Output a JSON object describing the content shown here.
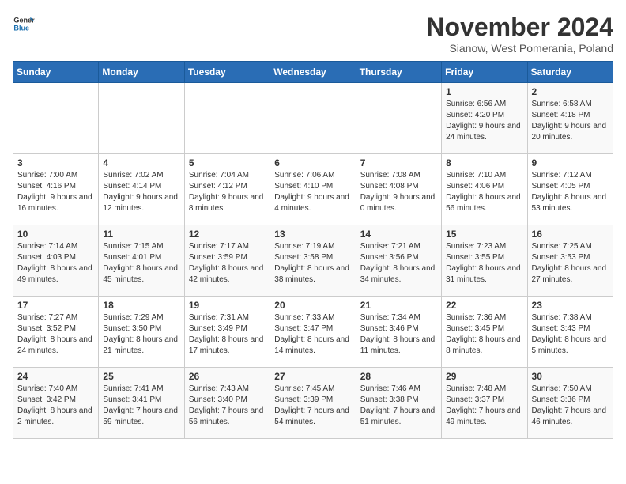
{
  "logo": {
    "general": "General",
    "blue": "Blue"
  },
  "title": "November 2024",
  "subtitle": "Sianow, West Pomerania, Poland",
  "days_of_week": [
    "Sunday",
    "Monday",
    "Tuesday",
    "Wednesday",
    "Thursday",
    "Friday",
    "Saturday"
  ],
  "weeks": [
    [
      {
        "day": "",
        "info": ""
      },
      {
        "day": "",
        "info": ""
      },
      {
        "day": "",
        "info": ""
      },
      {
        "day": "",
        "info": ""
      },
      {
        "day": "",
        "info": ""
      },
      {
        "day": "1",
        "info": "Sunrise: 6:56 AM\nSunset: 4:20 PM\nDaylight: 9 hours and 24 minutes."
      },
      {
        "day": "2",
        "info": "Sunrise: 6:58 AM\nSunset: 4:18 PM\nDaylight: 9 hours and 20 minutes."
      }
    ],
    [
      {
        "day": "3",
        "info": "Sunrise: 7:00 AM\nSunset: 4:16 PM\nDaylight: 9 hours and 16 minutes."
      },
      {
        "day": "4",
        "info": "Sunrise: 7:02 AM\nSunset: 4:14 PM\nDaylight: 9 hours and 12 minutes."
      },
      {
        "day": "5",
        "info": "Sunrise: 7:04 AM\nSunset: 4:12 PM\nDaylight: 9 hours and 8 minutes."
      },
      {
        "day": "6",
        "info": "Sunrise: 7:06 AM\nSunset: 4:10 PM\nDaylight: 9 hours and 4 minutes."
      },
      {
        "day": "7",
        "info": "Sunrise: 7:08 AM\nSunset: 4:08 PM\nDaylight: 9 hours and 0 minutes."
      },
      {
        "day": "8",
        "info": "Sunrise: 7:10 AM\nSunset: 4:06 PM\nDaylight: 8 hours and 56 minutes."
      },
      {
        "day": "9",
        "info": "Sunrise: 7:12 AM\nSunset: 4:05 PM\nDaylight: 8 hours and 53 minutes."
      }
    ],
    [
      {
        "day": "10",
        "info": "Sunrise: 7:14 AM\nSunset: 4:03 PM\nDaylight: 8 hours and 49 minutes."
      },
      {
        "day": "11",
        "info": "Sunrise: 7:15 AM\nSunset: 4:01 PM\nDaylight: 8 hours and 45 minutes."
      },
      {
        "day": "12",
        "info": "Sunrise: 7:17 AM\nSunset: 3:59 PM\nDaylight: 8 hours and 42 minutes."
      },
      {
        "day": "13",
        "info": "Sunrise: 7:19 AM\nSunset: 3:58 PM\nDaylight: 8 hours and 38 minutes."
      },
      {
        "day": "14",
        "info": "Sunrise: 7:21 AM\nSunset: 3:56 PM\nDaylight: 8 hours and 34 minutes."
      },
      {
        "day": "15",
        "info": "Sunrise: 7:23 AM\nSunset: 3:55 PM\nDaylight: 8 hours and 31 minutes."
      },
      {
        "day": "16",
        "info": "Sunrise: 7:25 AM\nSunset: 3:53 PM\nDaylight: 8 hours and 27 minutes."
      }
    ],
    [
      {
        "day": "17",
        "info": "Sunrise: 7:27 AM\nSunset: 3:52 PM\nDaylight: 8 hours and 24 minutes."
      },
      {
        "day": "18",
        "info": "Sunrise: 7:29 AM\nSunset: 3:50 PM\nDaylight: 8 hours and 21 minutes."
      },
      {
        "day": "19",
        "info": "Sunrise: 7:31 AM\nSunset: 3:49 PM\nDaylight: 8 hours and 17 minutes."
      },
      {
        "day": "20",
        "info": "Sunrise: 7:33 AM\nSunset: 3:47 PM\nDaylight: 8 hours and 14 minutes."
      },
      {
        "day": "21",
        "info": "Sunrise: 7:34 AM\nSunset: 3:46 PM\nDaylight: 8 hours and 11 minutes."
      },
      {
        "day": "22",
        "info": "Sunrise: 7:36 AM\nSunset: 3:45 PM\nDaylight: 8 hours and 8 minutes."
      },
      {
        "day": "23",
        "info": "Sunrise: 7:38 AM\nSunset: 3:43 PM\nDaylight: 8 hours and 5 minutes."
      }
    ],
    [
      {
        "day": "24",
        "info": "Sunrise: 7:40 AM\nSunset: 3:42 PM\nDaylight: 8 hours and 2 minutes."
      },
      {
        "day": "25",
        "info": "Sunrise: 7:41 AM\nSunset: 3:41 PM\nDaylight: 7 hours and 59 minutes."
      },
      {
        "day": "26",
        "info": "Sunrise: 7:43 AM\nSunset: 3:40 PM\nDaylight: 7 hours and 56 minutes."
      },
      {
        "day": "27",
        "info": "Sunrise: 7:45 AM\nSunset: 3:39 PM\nDaylight: 7 hours and 54 minutes."
      },
      {
        "day": "28",
        "info": "Sunrise: 7:46 AM\nSunset: 3:38 PM\nDaylight: 7 hours and 51 minutes."
      },
      {
        "day": "29",
        "info": "Sunrise: 7:48 AM\nSunset: 3:37 PM\nDaylight: 7 hours and 49 minutes."
      },
      {
        "day": "30",
        "info": "Sunrise: 7:50 AM\nSunset: 3:36 PM\nDaylight: 7 hours and 46 minutes."
      }
    ]
  ]
}
